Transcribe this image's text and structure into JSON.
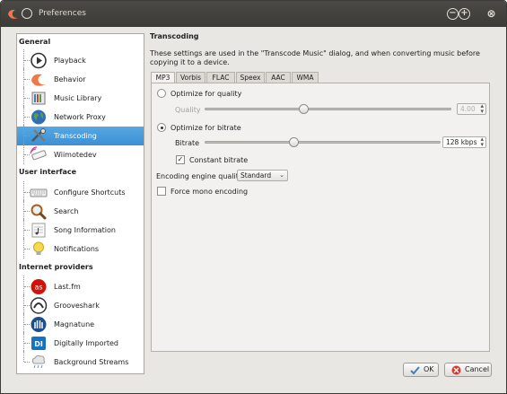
{
  "window": {
    "title": "Preferences"
  },
  "sidebar": {
    "categories": [
      "General",
      "User interface",
      "Internet providers"
    ],
    "items": [
      {
        "label": "Playback",
        "icon": "play-icon"
      },
      {
        "label": "Behavior",
        "icon": "clementine-icon"
      },
      {
        "label": "Music Library",
        "icon": "library-icon"
      },
      {
        "label": "Network Proxy",
        "icon": "globe-icon"
      },
      {
        "label": "Transcoding",
        "icon": "transcode-icon",
        "selected": true
      },
      {
        "label": "Wiimotedev",
        "icon": "wiimote-icon"
      },
      {
        "label": "Configure Shortcuts",
        "icon": "keyboard-icon"
      },
      {
        "label": "Search",
        "icon": "search-icon"
      },
      {
        "label": "Song Information",
        "icon": "music-sheet-icon"
      },
      {
        "label": "Notifications",
        "icon": "lightbulb-icon"
      },
      {
        "label": "Last.fm",
        "icon": "lastfm-icon"
      },
      {
        "label": "Grooveshark",
        "icon": "grooveshark-icon"
      },
      {
        "label": "Magnatune",
        "icon": "magnatune-icon"
      },
      {
        "label": "Digitally Imported",
        "icon": "di-icon"
      },
      {
        "label": "Background Streams",
        "icon": "rain-icon"
      }
    ]
  },
  "main": {
    "title": "Transcoding",
    "description": "These settings are used in the \"Transcode Music\" dialog, and when converting music before copying it to a device.",
    "tabs": [
      "MP3",
      "Vorbis",
      "FLAC",
      "Speex",
      "AAC",
      "WMA"
    ],
    "active_tab": "MP3",
    "optimize_quality_label": "Optimize for quality",
    "quality_label": "Quality",
    "quality_value": "4.00",
    "quality_slider": 0.4,
    "optimize_bitrate_label": "Optimize for bitrate",
    "bitrate_label": "Bitrate",
    "bitrate_value": "128 kbps",
    "bitrate_slider": 0.38,
    "constant_bitrate_label": "Constant bitrate",
    "constant_bitrate_checked": true,
    "engine_quality_label": "Encoding engine quality",
    "engine_quality_value": "Standard",
    "force_mono_label": "Force mono encoding",
    "force_mono_checked": false
  },
  "footer": {
    "ok_label": "OK",
    "cancel_label": "Cancel"
  },
  "colors": {
    "selection": "#3b8fd3",
    "titlebar": "#3c3b37",
    "accent": "#f07746"
  }
}
